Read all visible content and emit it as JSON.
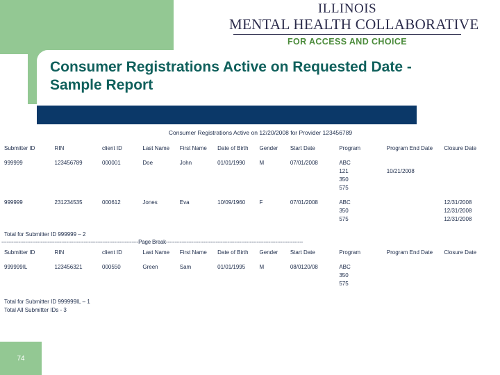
{
  "logo": {
    "line1": "ILLINOIS",
    "line2": "MENTAL HEALTH COLLABORATIVE",
    "tagline": "FOR ACCESS AND CHOICE"
  },
  "slide": {
    "title": "Consumer Registrations Active on Requested Date -  Sample Report",
    "page_number": "74"
  },
  "colors": {
    "green": "#93c893",
    "navy": "#0b3868",
    "title_teal": "#10605c",
    "tagline_green": "#4b8b3b",
    "report_text": "#1b2a49"
  },
  "report": {
    "subtitle": "Consumer Registrations Active on 12/20/2008 for Provider 123456789",
    "headers": [
      "Submitter ID",
      "RIN",
      "client ID",
      "Last Name",
      "First Name",
      "Date of Birth",
      "Gender",
      "Start Date",
      "Program",
      "Program End Date",
      "Closure Date"
    ],
    "section1": {
      "rows": [
        {
          "submitter_id": "999999",
          "rin": "123456789",
          "client_id": "000001",
          "last_name": "Doe",
          "first_name": "John",
          "dob": "01/01/1990",
          "gender": "M",
          "start_date": "07/01/2008",
          "programs": [
            "ABC",
            "121",
            "350",
            "575"
          ],
          "program_end_dates": [
            "",
            "10/21/2008",
            "",
            ""
          ],
          "closure_dates": [
            "",
            "",
            "",
            ""
          ]
        },
        {
          "submitter_id": "999999",
          "rin": "231234535",
          "client_id": "000612",
          "last_name": "Jones",
          "first_name": "Eva",
          "dob": "10/09/1960",
          "gender": "F",
          "start_date": "07/01/2008",
          "programs": [
            "ABC",
            "350",
            "575"
          ],
          "program_end_dates": [
            "",
            "",
            ""
          ],
          "closure_dates": [
            "12/31/2008",
            "12/31/2008",
            "12/31/2008"
          ]
        }
      ],
      "total": "Total for Submitter ID 999999 – 2"
    },
    "page_break_label": "Page  Break",
    "page_break_line": "--------------------------------------------------------------------------------Page  Break--------------------------------------------------------------------------------",
    "section2": {
      "rows": [
        {
          "submitter_id": "999999IL",
          "rin": "123456321",
          "client_id": "000550",
          "last_name": "Green",
          "first_name": "Sam",
          "dob": "01/01/1995",
          "gender": "M",
          "start_date": "08/0120/08",
          "programs": [
            "ABC",
            "350",
            "575"
          ],
          "program_end_dates": [
            "",
            "",
            ""
          ],
          "closure_dates": [
            "",
            "",
            ""
          ]
        }
      ],
      "total": "Total for Submitter ID 999999IL – 1"
    },
    "grand_total": "Total All Submitter IDs - 3"
  }
}
